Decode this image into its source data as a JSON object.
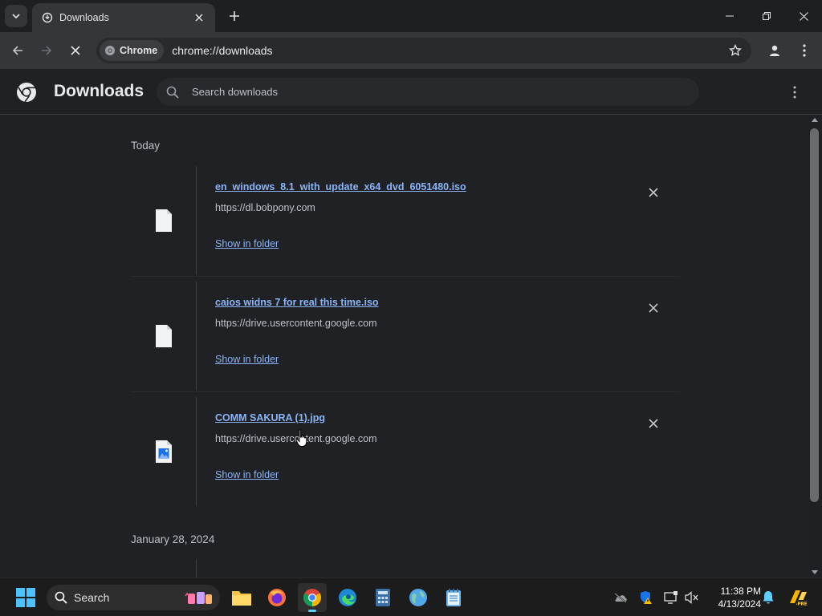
{
  "browser": {
    "tab": {
      "title": "Downloads"
    },
    "omnibox": {
      "chip_label": "Chrome",
      "url": "chrome://downloads"
    }
  },
  "downloads_page": {
    "title": "Downloads",
    "search_placeholder": "Search downloads",
    "groups": [
      {
        "date": "Today",
        "items": [
          {
            "name": "en_windows_8.1_with_update_x64_dvd_6051480.iso",
            "source": "https://dl.bobpony.com",
            "action": "Show in folder",
            "file_type": "document-icon"
          },
          {
            "name": "caios widns 7 for real this time.iso",
            "source": "https://drive.usercontent.google.com",
            "action": "Show in folder",
            "file_type": "document-icon"
          },
          {
            "name": "COMM SAKURA (1).jpg",
            "source": "https://drive.usercontent.google.com",
            "action": "Show in folder",
            "file_type": "image-file-icon"
          }
        ]
      },
      {
        "date": "January 28, 2024",
        "items": []
      }
    ]
  },
  "taskbar": {
    "search_label": "Search",
    "clock": {
      "time": "11:38 PM",
      "date": "4/13/2024"
    }
  },
  "colors": {
    "accent_link": "#8ab4f8",
    "page_bg": "#202124",
    "toolbar_bg": "#35363a"
  }
}
